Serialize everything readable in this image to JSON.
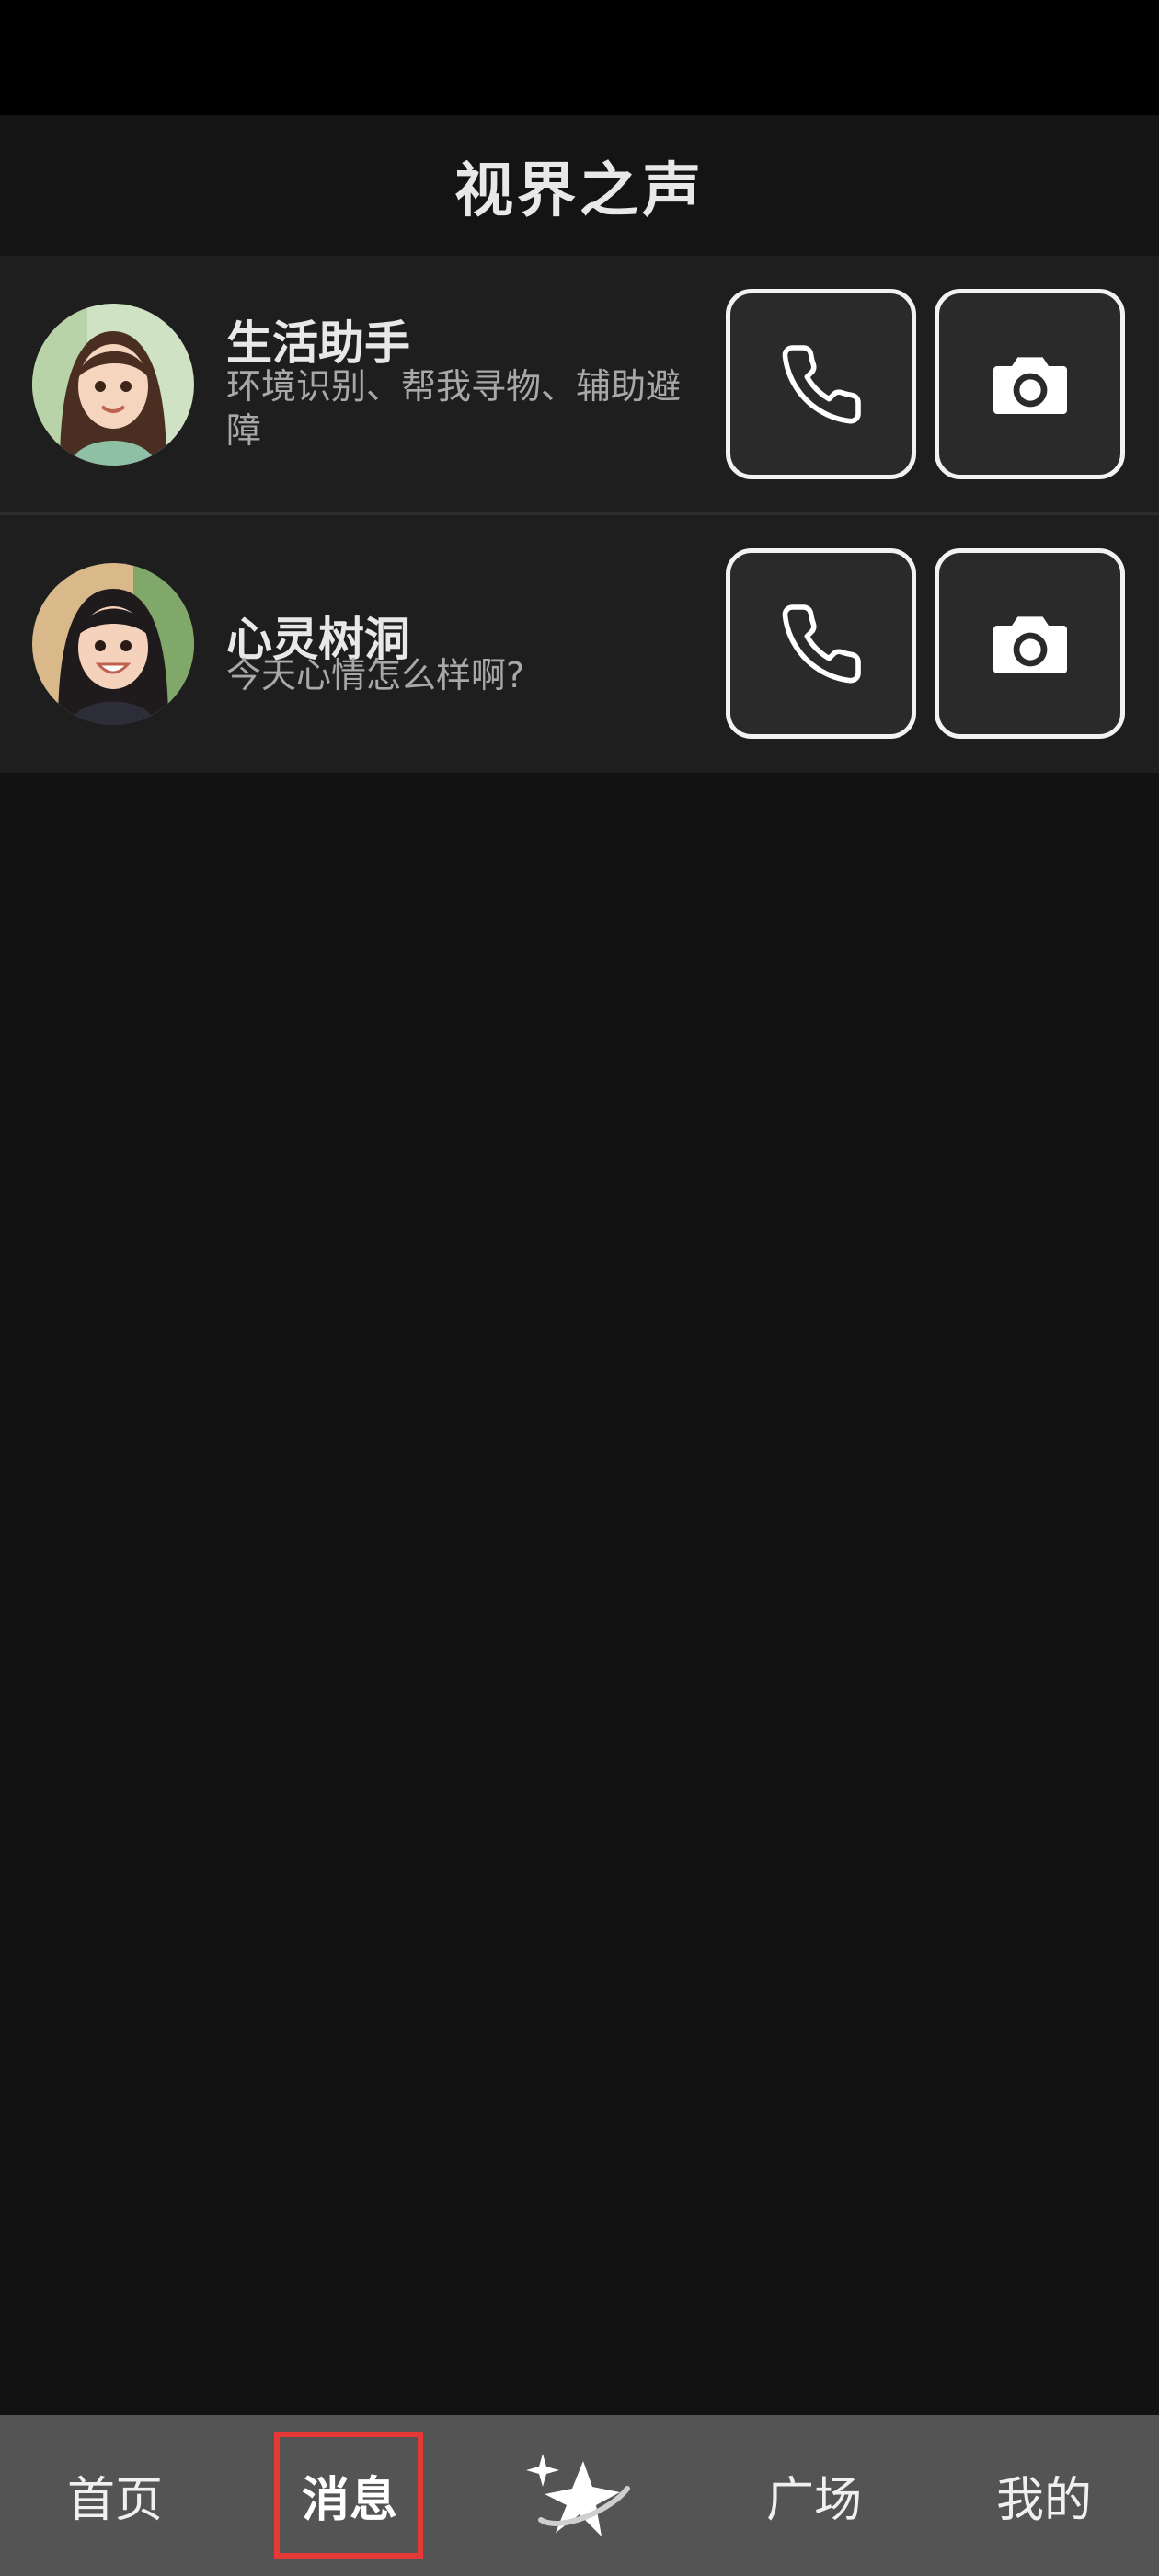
{
  "app": {
    "title": "视界之声"
  },
  "contacts": [
    {
      "name": "生活助手",
      "description": "环境识别、帮我寻物、辅助避障",
      "avatar": "woman-avatar-1",
      "call_icon": "phone-icon",
      "camera_icon": "camera-icon"
    },
    {
      "name": "心灵树洞",
      "description": "今天心情怎么样啊?",
      "avatar": "woman-avatar-2",
      "call_icon": "phone-icon",
      "camera_icon": "camera-icon"
    }
  ],
  "bottom_nav": {
    "items": [
      {
        "label": "首页"
      },
      {
        "label": "消息",
        "selected": true
      },
      {
        "label": "",
        "icon": "sparkle-star-icon"
      },
      {
        "label": "广场"
      },
      {
        "label": "我的"
      }
    ]
  },
  "colors": {
    "background": "#121212",
    "card": "#1e1e1e",
    "nav": "#545454",
    "highlight": "#e53935"
  }
}
